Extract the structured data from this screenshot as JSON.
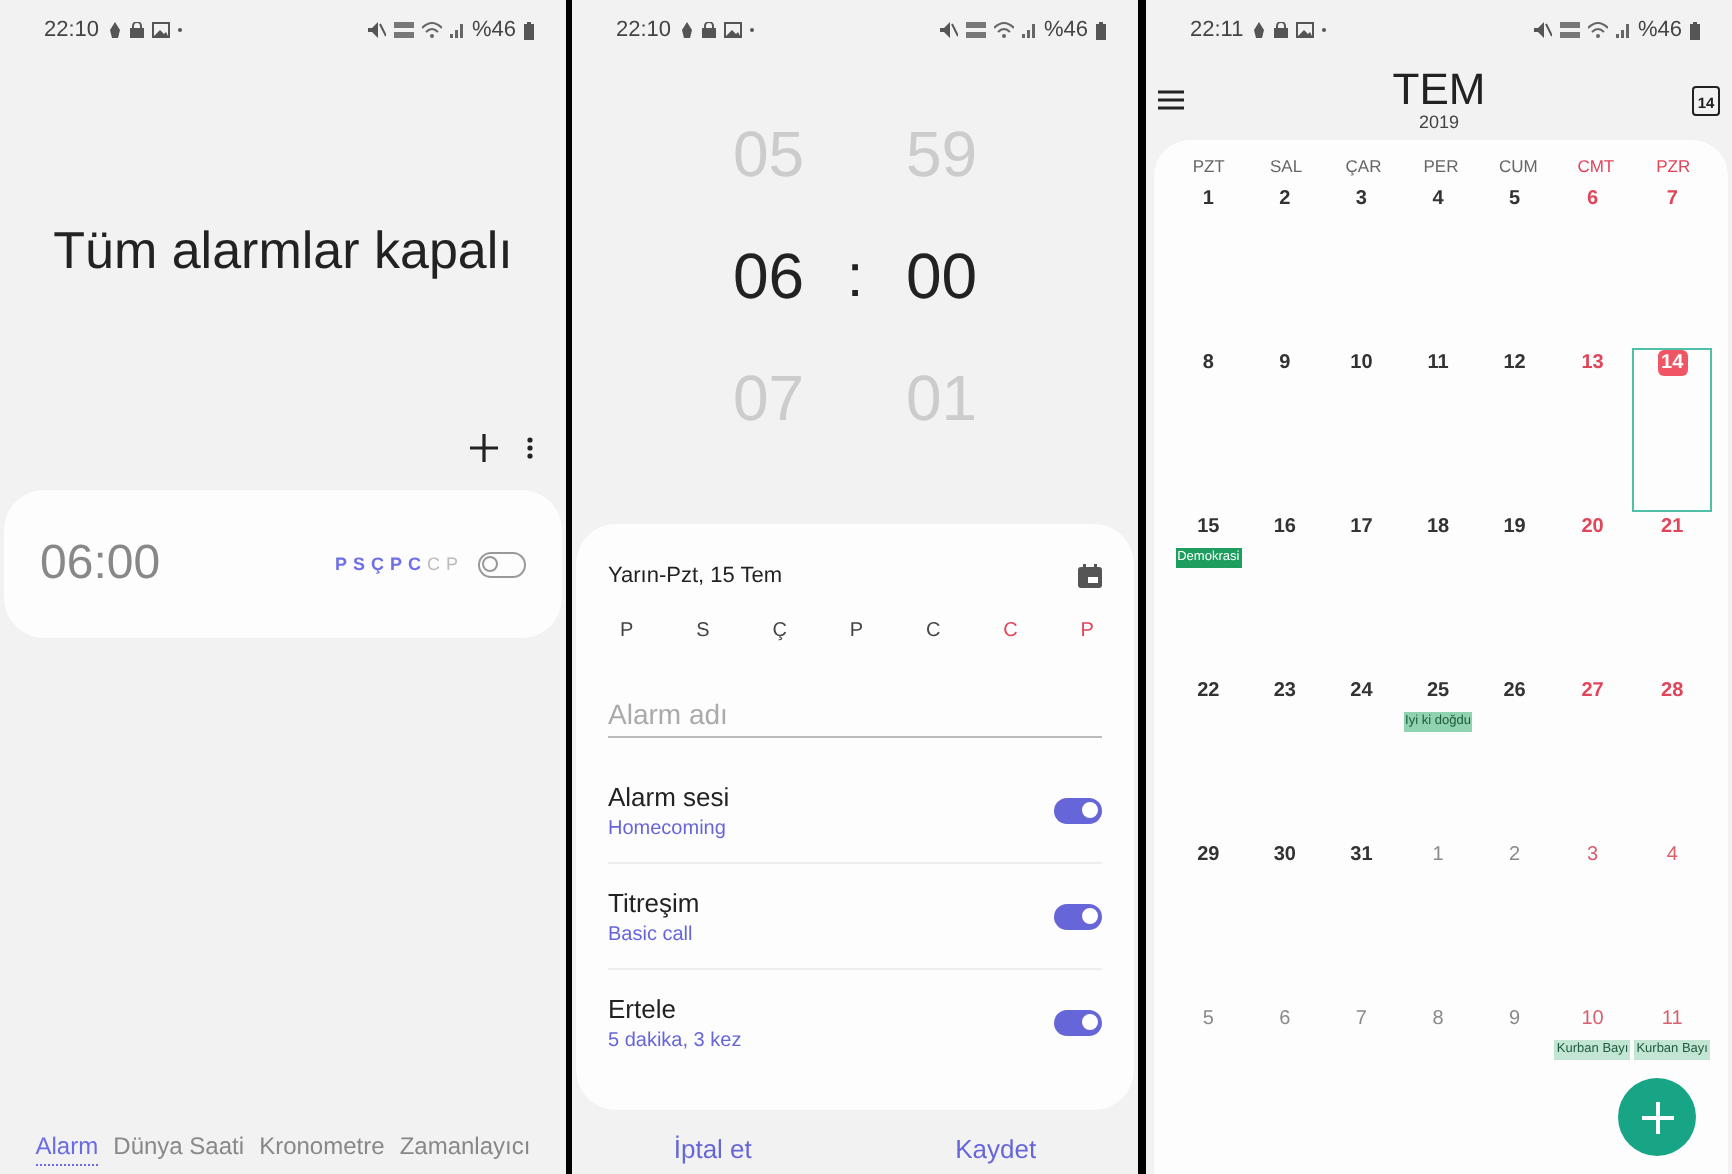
{
  "alarm_list": {
    "status_bar": {
      "time": "22:10",
      "battery": "%46"
    },
    "title": "Tüm alarmlar kapalı",
    "alarms": [
      {
        "time": "06:00",
        "on": false,
        "days": [
          {
            "label": "P",
            "active": true
          },
          {
            "label": "S",
            "active": true
          },
          {
            "label": "Ç",
            "active": true
          },
          {
            "label": "P",
            "active": true
          },
          {
            "label": "C",
            "active": true
          },
          {
            "label": "C",
            "active": false
          },
          {
            "label": "P",
            "active": false
          }
        ]
      }
    ],
    "tabs": [
      {
        "label": "Alarm",
        "selected": true
      },
      {
        "label": "Dünya Saati",
        "selected": false
      },
      {
        "label": "Kronometre",
        "selected": false
      },
      {
        "label": "Zamanlayıcı",
        "selected": false
      }
    ]
  },
  "alarm_edit": {
    "status_bar": {
      "time": "22:10",
      "battery": "%46"
    },
    "hours": [
      {
        "value": "05",
        "selected": false
      },
      {
        "value": "06",
        "selected": true
      },
      {
        "value": "07",
        "selected": false
      }
    ],
    "separator": ":",
    "minutes": [
      {
        "value": "59",
        "selected": false
      },
      {
        "value": "00",
        "selected": true
      },
      {
        "value": "01",
        "selected": false
      }
    ],
    "date": "Yarın-Pzt, 15 Tem",
    "days": [
      {
        "label": "P",
        "weekend": false
      },
      {
        "label": "S",
        "weekend": false
      },
      {
        "label": "Ç",
        "weekend": false
      },
      {
        "label": "P",
        "weekend": false
      },
      {
        "label": "C",
        "weekend": false
      },
      {
        "label": "C",
        "weekend": true
      },
      {
        "label": "P",
        "weekend": true
      }
    ],
    "name_field": {
      "placeholder": "Alarm adı"
    },
    "settings": [
      {
        "title": "Alarm sesi",
        "value": "Homecoming",
        "on": true
      },
      {
        "title": "Titreşim",
        "value": "Basic call",
        "on": true
      },
      {
        "title": "Ertele",
        "value": "5 dakika, 3 kez",
        "on": true
      }
    ],
    "buttons": [
      "İptal et",
      "Kaydet"
    ]
  },
  "calendar": {
    "status_bar": {
      "time": "22:11",
      "battery": "%46"
    },
    "month": "TEM",
    "year": "2019",
    "today_icon": "14",
    "weekdays": [
      {
        "label": "PZT",
        "weekend": false
      },
      {
        "label": "SAL",
        "weekend": false
      },
      {
        "label": "ÇAR",
        "weekend": false
      },
      {
        "label": "PER",
        "weekend": false
      },
      {
        "label": "CUM",
        "weekend": false
      },
      {
        "label": "CMT",
        "weekend": true
      },
      {
        "label": "PZR",
        "weekend": true
      }
    ],
    "weeks": [
      [
        {
          "day": "1",
          "weekend": false,
          "other_month": false,
          "today": false,
          "selected": false
        },
        {
          "day": "2",
          "weekend": false,
          "other_month": false,
          "today": false,
          "selected": false
        },
        {
          "day": "3",
          "weekend": false,
          "other_month": false,
          "today": false,
          "selected": false
        },
        {
          "day": "4",
          "weekend": false,
          "other_month": false,
          "today": false,
          "selected": false
        },
        {
          "day": "5",
          "weekend": false,
          "other_month": false,
          "today": false,
          "selected": false
        },
        {
          "day": "6",
          "weekend": true,
          "other_month": false,
          "today": false,
          "selected": false
        },
        {
          "day": "7",
          "weekend": true,
          "other_month": false,
          "today": false,
          "selected": false
        }
      ],
      [
        {
          "day": "8",
          "weekend": false,
          "other_month": false,
          "today": false,
          "selected": false
        },
        {
          "day": "9",
          "weekend": false,
          "other_month": false,
          "today": false,
          "selected": false
        },
        {
          "day": "10",
          "weekend": false,
          "other_month": false,
          "today": false,
          "selected": false
        },
        {
          "day": "11",
          "weekend": false,
          "other_month": false,
          "today": false,
          "selected": false
        },
        {
          "day": "12",
          "weekend": false,
          "other_month": false,
          "today": false,
          "selected": false
        },
        {
          "day": "13",
          "weekend": true,
          "other_month": false,
          "today": false,
          "selected": false
        },
        {
          "day": "14",
          "weekend": true,
          "other_month": false,
          "today": true,
          "selected": true
        }
      ],
      [
        {
          "day": "15",
          "weekend": false,
          "other_month": false,
          "today": false,
          "selected": false,
          "events": [
            {
              "title": "Demokrasi",
              "color": "#1e9e5e"
            }
          ]
        },
        {
          "day": "16",
          "weekend": false,
          "other_month": false,
          "today": false,
          "selected": false
        },
        {
          "day": "17",
          "weekend": false,
          "other_month": false,
          "today": false,
          "selected": false
        },
        {
          "day": "18",
          "weekend": false,
          "other_month": false,
          "today": false,
          "selected": false
        },
        {
          "day": "19",
          "weekend": false,
          "other_month": false,
          "today": false,
          "selected": false
        },
        {
          "day": "20",
          "weekend": true,
          "other_month": false,
          "today": false,
          "selected": false
        },
        {
          "day": "21",
          "weekend": true,
          "other_month": false,
          "today": false,
          "selected": false
        }
      ],
      [
        {
          "day": "22",
          "weekend": false,
          "other_month": false,
          "today": false,
          "selected": false
        },
        {
          "day": "23",
          "weekend": false,
          "other_month": false,
          "today": false,
          "selected": false
        },
        {
          "day": "24",
          "weekend": false,
          "other_month": false,
          "today": false,
          "selected": false
        },
        {
          "day": "25",
          "weekend": false,
          "other_month": false,
          "today": false,
          "selected": false,
          "events": [
            {
              "title": "Iyi ki doğdu",
              "color": "#8fd3b0"
            }
          ]
        },
        {
          "day": "26",
          "weekend": false,
          "other_month": false,
          "today": false,
          "selected": false
        },
        {
          "day": "27",
          "weekend": true,
          "other_month": false,
          "today": false,
          "selected": false
        },
        {
          "day": "28",
          "weekend": true,
          "other_month": false,
          "today": false,
          "selected": false
        }
      ],
      [
        {
          "day": "29",
          "weekend": false,
          "other_month": false,
          "today": false,
          "selected": false
        },
        {
          "day": "30",
          "weekend": false,
          "other_month": false,
          "today": false,
          "selected": false
        },
        {
          "day": "31",
          "weekend": false,
          "other_month": false,
          "today": false,
          "selected": false
        },
        {
          "day": "1",
          "weekend": false,
          "other_month": true,
          "today": false,
          "selected": false
        },
        {
          "day": "2",
          "weekend": false,
          "other_month": true,
          "today": false,
          "selected": false
        },
        {
          "day": "3",
          "weekend": true,
          "other_month": true,
          "today": false,
          "selected": false
        },
        {
          "day": "4",
          "weekend": true,
          "other_month": true,
          "today": false,
          "selected": false
        }
      ],
      [
        {
          "day": "5",
          "weekend": false,
          "other_month": true,
          "today": false,
          "selected": false
        },
        {
          "day": "6",
          "weekend": false,
          "other_month": true,
          "today": false,
          "selected": false
        },
        {
          "day": "7",
          "weekend": false,
          "other_month": true,
          "today": false,
          "selected": false
        },
        {
          "day": "8",
          "weekend": false,
          "other_month": true,
          "today": false,
          "selected": false
        },
        {
          "day": "9",
          "weekend": false,
          "other_month": true,
          "today": false,
          "selected": false
        },
        {
          "day": "10",
          "weekend": true,
          "other_month": true,
          "today": false,
          "selected": false,
          "events": [
            {
              "title": "Kurban Bayı",
              "color": "#c2e6d3"
            }
          ]
        },
        {
          "day": "11",
          "weekend": true,
          "other_month": true,
          "today": false,
          "selected": false,
          "events": [
            {
              "title": "Kurban Bayı",
              "color": "#c2e6d3"
            }
          ]
        }
      ]
    ]
  }
}
